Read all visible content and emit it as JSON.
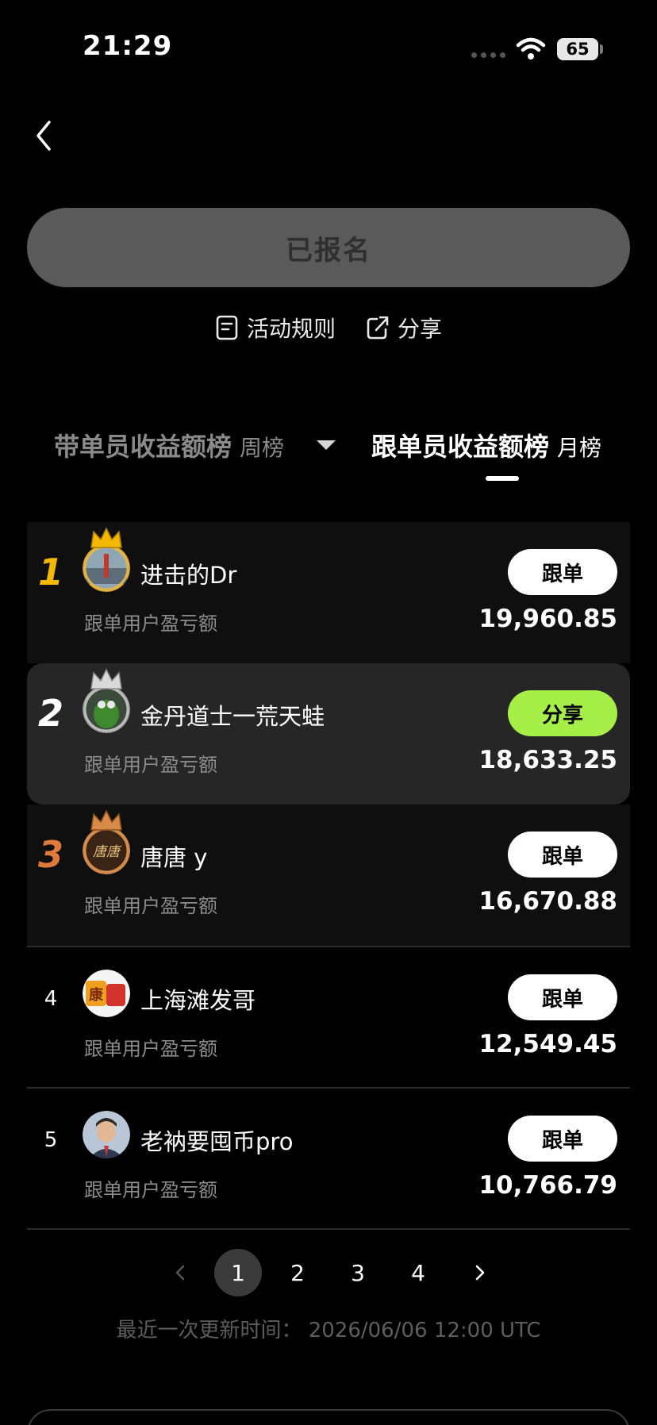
{
  "status_bar": {
    "time": "21:29",
    "battery": "65"
  },
  "signup": {
    "label": "已报名"
  },
  "links": {
    "rules": "活动规则",
    "share": "分享"
  },
  "tabs": [
    {
      "title": "带单员收益额榜",
      "period": "周榜",
      "active": false
    },
    {
      "title": "跟单员收益额榜",
      "period": "月榜",
      "active": true
    }
  ],
  "ranking": [
    {
      "rank": "1",
      "name": "进击的Dr",
      "metric": "跟单用户盈亏额",
      "amount": "19,960.85",
      "action": "跟单"
    },
    {
      "rank": "2",
      "name": "金丹道士一荒天蛙",
      "metric": "跟单用户盈亏额",
      "amount": "18,633.25",
      "action": "分享"
    },
    {
      "rank": "3",
      "name": "唐唐 y",
      "metric": "跟单用户盈亏额",
      "amount": "16,670.88",
      "action": "跟单"
    },
    {
      "rank": "4",
      "name": "上海滩发哥",
      "metric": "跟单用户盈亏额",
      "amount": "12,549.45",
      "action": "跟单"
    },
    {
      "rank": "5",
      "name": "老衲要囤币pro",
      "metric": "跟单用户盈亏额",
      "amount": "10,766.79",
      "action": "跟单"
    }
  ],
  "pagination": {
    "pages": [
      "1",
      "2",
      "3",
      "4"
    ],
    "current": "1"
  },
  "update_time": "最近一次更新时间： 2026/06/06 12:00 UTC",
  "colors": {
    "gold": "#f5b800",
    "silver": "#ffffff",
    "bronze": "#e07a3c",
    "share_button": "#a6ef48",
    "signup_button": "#5a5a5a"
  },
  "icons": {
    "back": "chevron-left-icon",
    "rules": "document-icon",
    "share": "external-share-icon",
    "dropdown": "triangle-down-icon",
    "crown": "crown-icon",
    "prev": "chevron-left-icon",
    "next": "chevron-right-icon"
  }
}
